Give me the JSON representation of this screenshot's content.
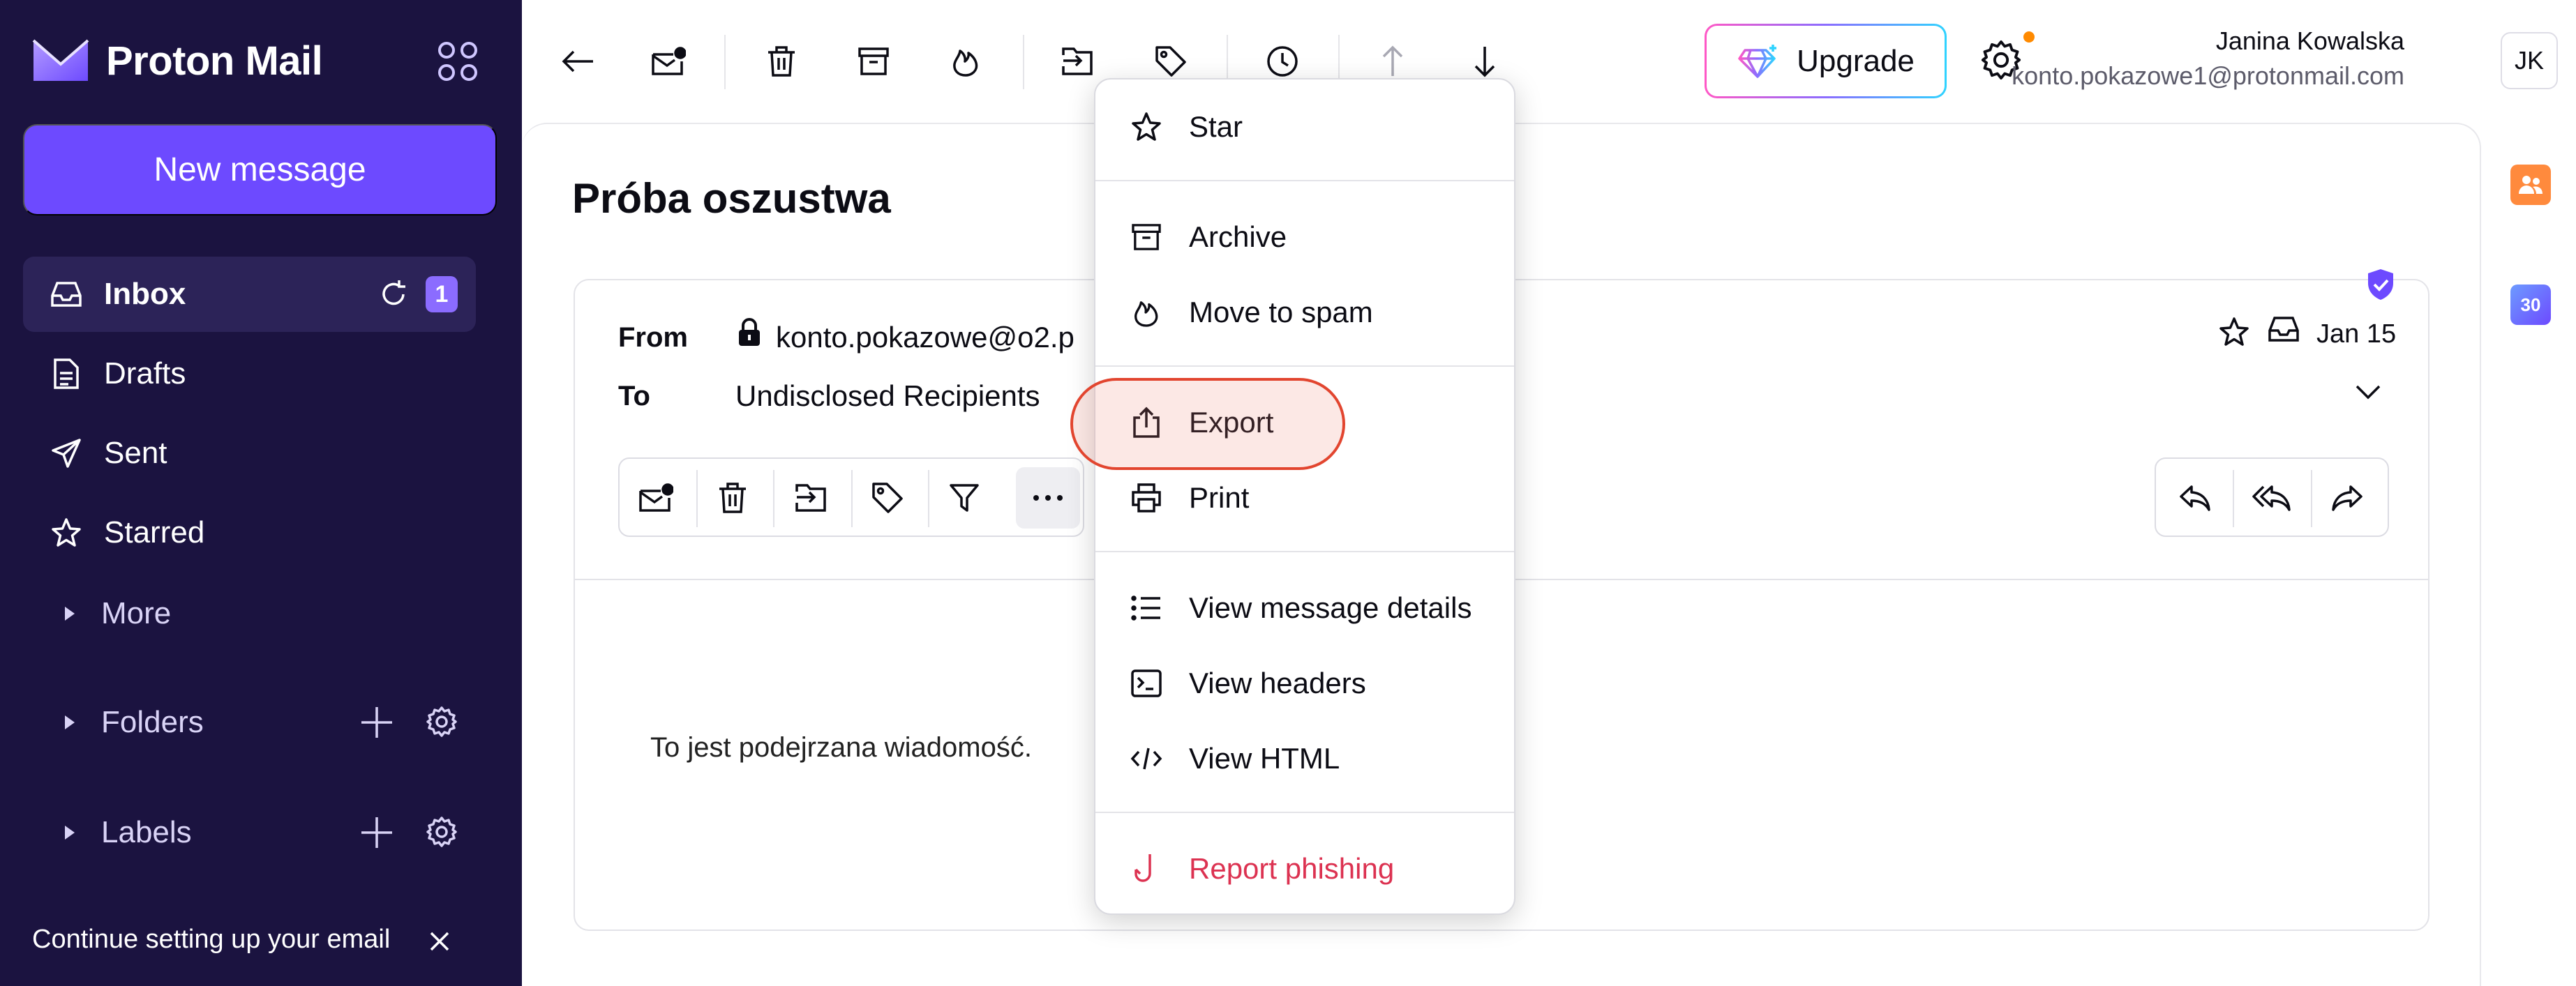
{
  "brand": {
    "name": "Proton Mail"
  },
  "sidebar": {
    "new_message_label": "New message",
    "items": [
      {
        "label": "Inbox",
        "badge": "1"
      },
      {
        "label": "Drafts"
      },
      {
        "label": "Sent"
      },
      {
        "label": "Starred"
      },
      {
        "label": "More"
      }
    ],
    "folders_label": "Folders",
    "labels_label": "Labels",
    "setup_text": "Continue setting up your email"
  },
  "header": {
    "upgrade_label": "Upgrade",
    "user_name": "Janina Kowalska",
    "user_email": "konto.pokazowe1@protonmail.com",
    "avatar_initials": "JK"
  },
  "message": {
    "subject": "Próba oszustwa",
    "from_label": "From",
    "from_value": "konto.pokazowe@o2.p",
    "to_label": "To",
    "to_value": "Undisclosed Recipients",
    "date": "Jan 15",
    "body": "To jest podejrzana wiadomość."
  },
  "rail": {
    "calendar_day": "30"
  },
  "menu": {
    "items": [
      {
        "label": "Star",
        "icon": "star-icon"
      },
      {
        "label": "Archive",
        "icon": "archive-icon"
      },
      {
        "label": "Move to spam",
        "icon": "fire-icon"
      },
      {
        "label": "Export",
        "icon": "export-icon"
      },
      {
        "label": "Print",
        "icon": "printer-icon"
      },
      {
        "label": "View message details",
        "icon": "list-icon"
      },
      {
        "label": "View headers",
        "icon": "terminal-icon"
      },
      {
        "label": "View HTML",
        "icon": "code-icon"
      },
      {
        "label": "Report phishing",
        "icon": "hook-icon"
      }
    ]
  },
  "colors": {
    "sidebar_bg": "#1b1340",
    "accent": "#6d4aff",
    "danger": "#dc3251",
    "notification": "#ff8a00",
    "highlight_ring": "#e2452f"
  }
}
